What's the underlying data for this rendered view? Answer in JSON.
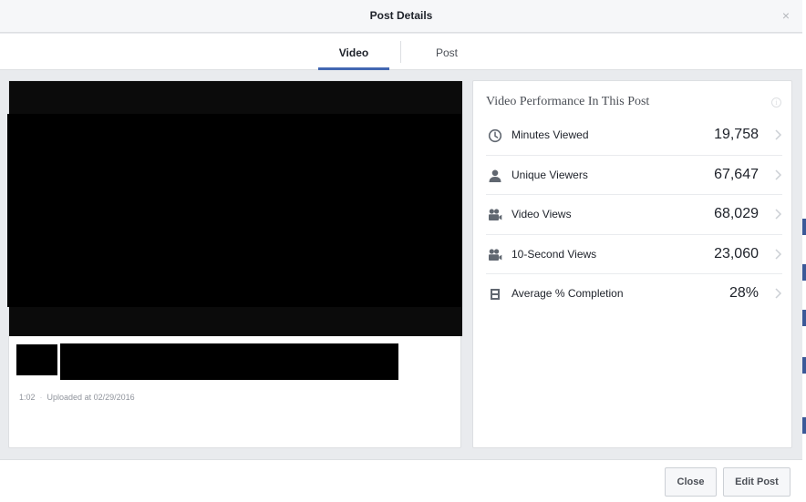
{
  "dialog": {
    "title": "Post Details",
    "close_glyph": "×"
  },
  "tabs": [
    {
      "label": "Video",
      "active": true
    },
    {
      "label": "Post",
      "active": false
    }
  ],
  "video": {
    "duration": "1:02",
    "separator": "·",
    "uploaded": "Uploaded at 02/29/2016"
  },
  "performance": {
    "title": "Video Performance In This Post",
    "info_icon": "info-icon",
    "metrics": [
      {
        "icon": "clock-icon",
        "label": "Minutes Viewed",
        "value": "19,758"
      },
      {
        "icon": "person-icon",
        "label": "Unique Viewers",
        "value": "67,647"
      },
      {
        "icon": "video-camera-icon",
        "label": "Video Views",
        "value": "68,029"
      },
      {
        "icon": "video-camera-icon",
        "label": "10-Second Views",
        "value": "23,060"
      },
      {
        "icon": "film-strip-icon",
        "label": "Average % Completion",
        "value": "28%"
      }
    ]
  },
  "footer": {
    "close_label": "Close",
    "edit_label": "Edit Post"
  },
  "colors": {
    "accent": "#4267b2",
    "text": "#1d2129",
    "muted": "#90949c",
    "background": "#e9ebee"
  }
}
